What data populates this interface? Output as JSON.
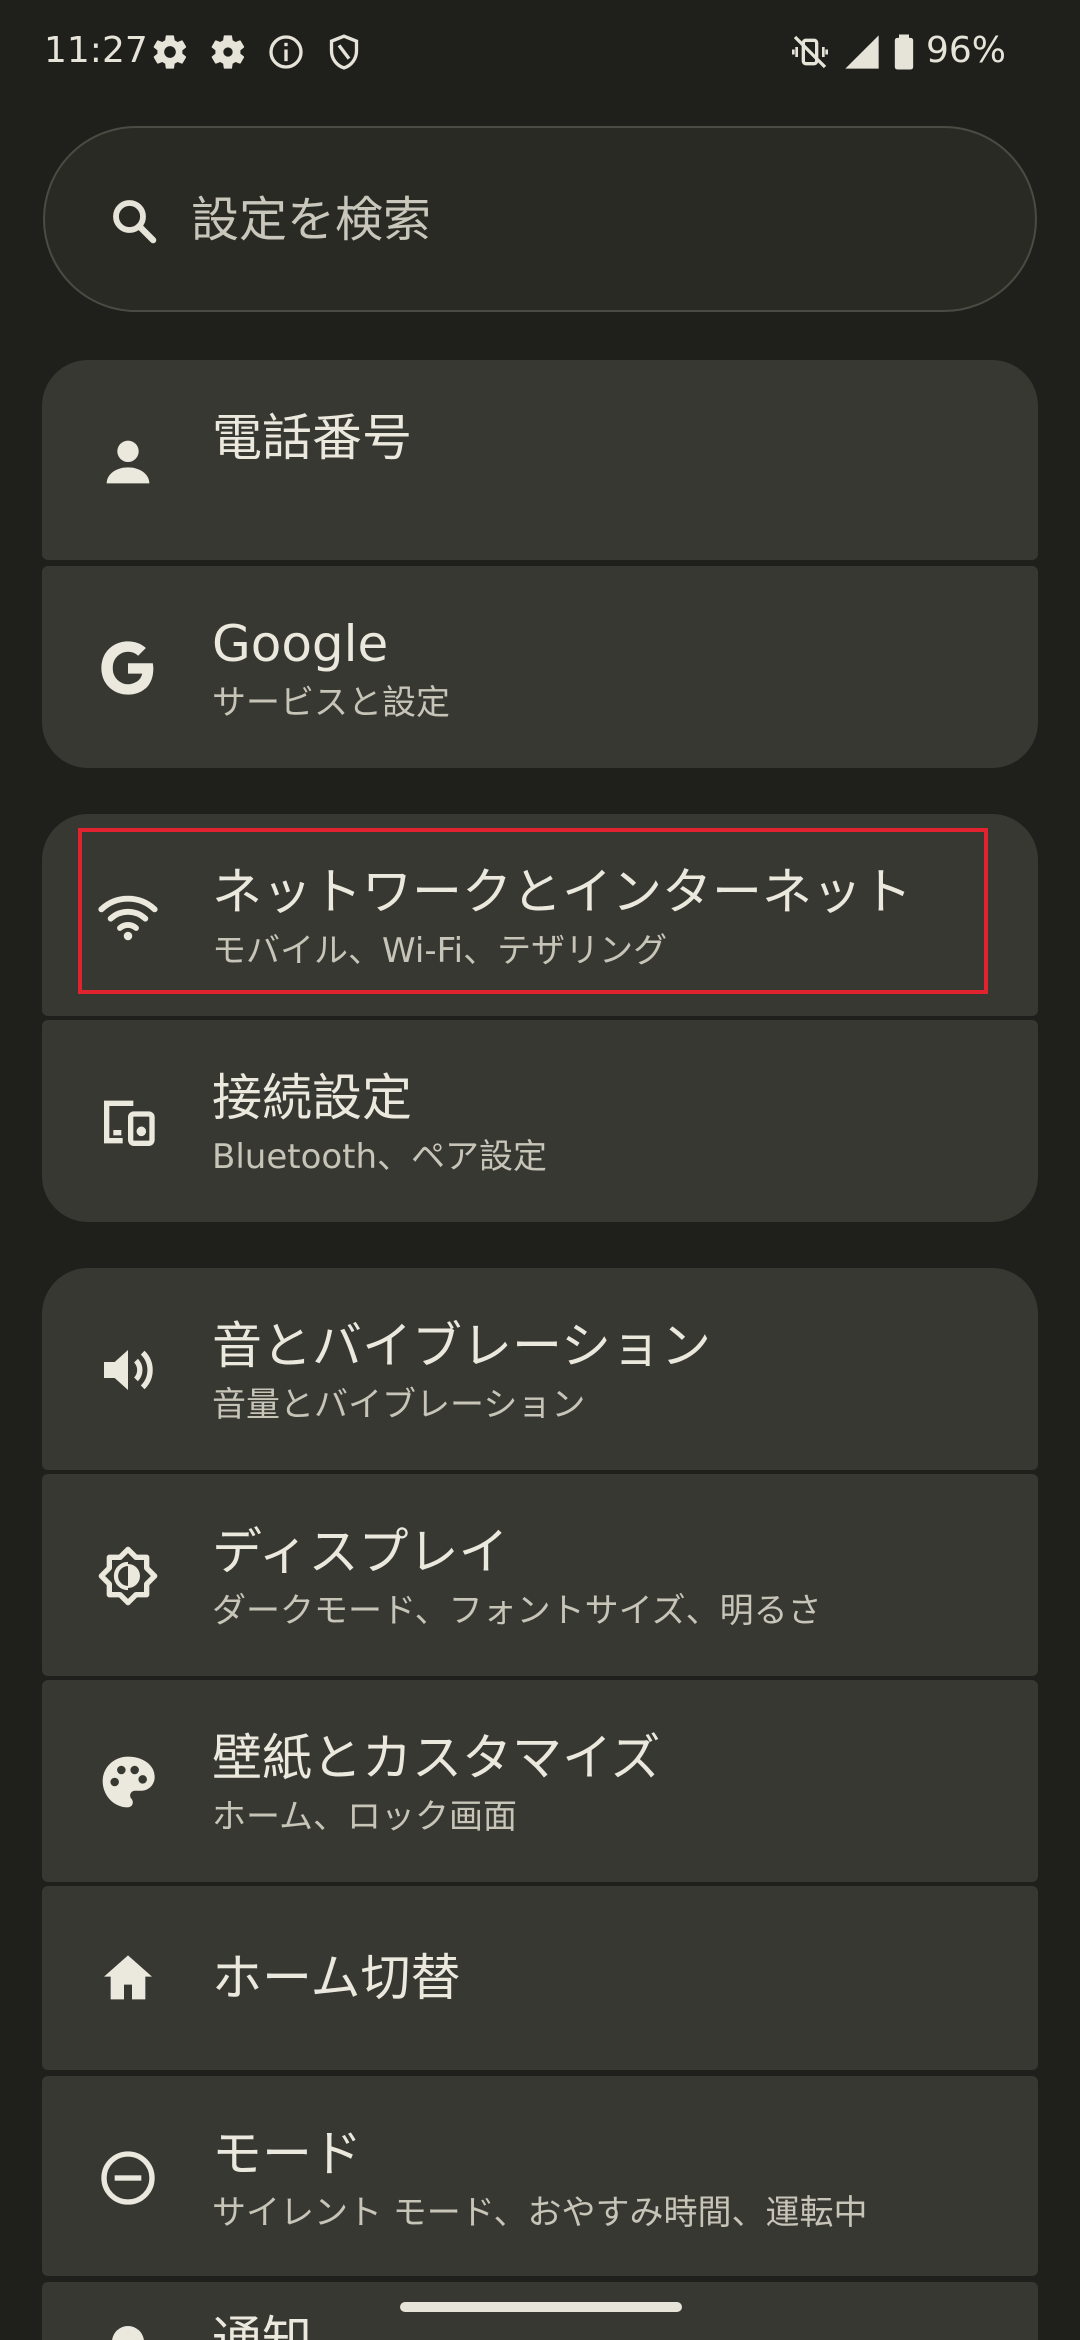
{
  "status_bar": {
    "time": "11:27",
    "battery": "96%",
    "icons": [
      "gear-icon",
      "gear-icon",
      "info-icon",
      "shield-icon",
      "vibrate-off-icon",
      "signal-icon",
      "battery-icon"
    ]
  },
  "search": {
    "placeholder": "設定を検索"
  },
  "items": [
    {
      "title": "電話番号",
      "subtitle": "",
      "icon": "person-icon"
    },
    {
      "title": "Google",
      "subtitle": "サービスと設定",
      "icon": "google-icon"
    },
    {
      "title": "ネットワークとインターネット",
      "subtitle": "モバイル、Wi-Fi、テザリング",
      "icon": "wifi-icon"
    },
    {
      "title": "接続設定",
      "subtitle": "Bluetooth、ペア設定",
      "icon": "devices-icon"
    },
    {
      "title": "音とバイブレーション",
      "subtitle": "音量とバイブレーション",
      "icon": "volume-icon"
    },
    {
      "title": "ディスプレイ",
      "subtitle": "ダークモード、フォントサイズ、明るさ",
      "icon": "brightness-icon"
    },
    {
      "title": "壁紙とカスタマイズ",
      "subtitle": "ホーム、ロック画面",
      "icon": "palette-icon"
    },
    {
      "title": "ホーム切替",
      "subtitle": "",
      "icon": "home-icon"
    },
    {
      "title": "モード",
      "subtitle": "サイレント モード、おやすみ時間、運転中",
      "icon": "do-not-disturb-icon"
    },
    {
      "title": "通知",
      "subtitle": "",
      "icon": "bell-icon"
    }
  ],
  "colors": {
    "background": "#1f201b",
    "card": "#383833",
    "text_primary": "#ebe8dd",
    "text_secondary": "#c7c4b8",
    "highlight": "#e0232e"
  }
}
